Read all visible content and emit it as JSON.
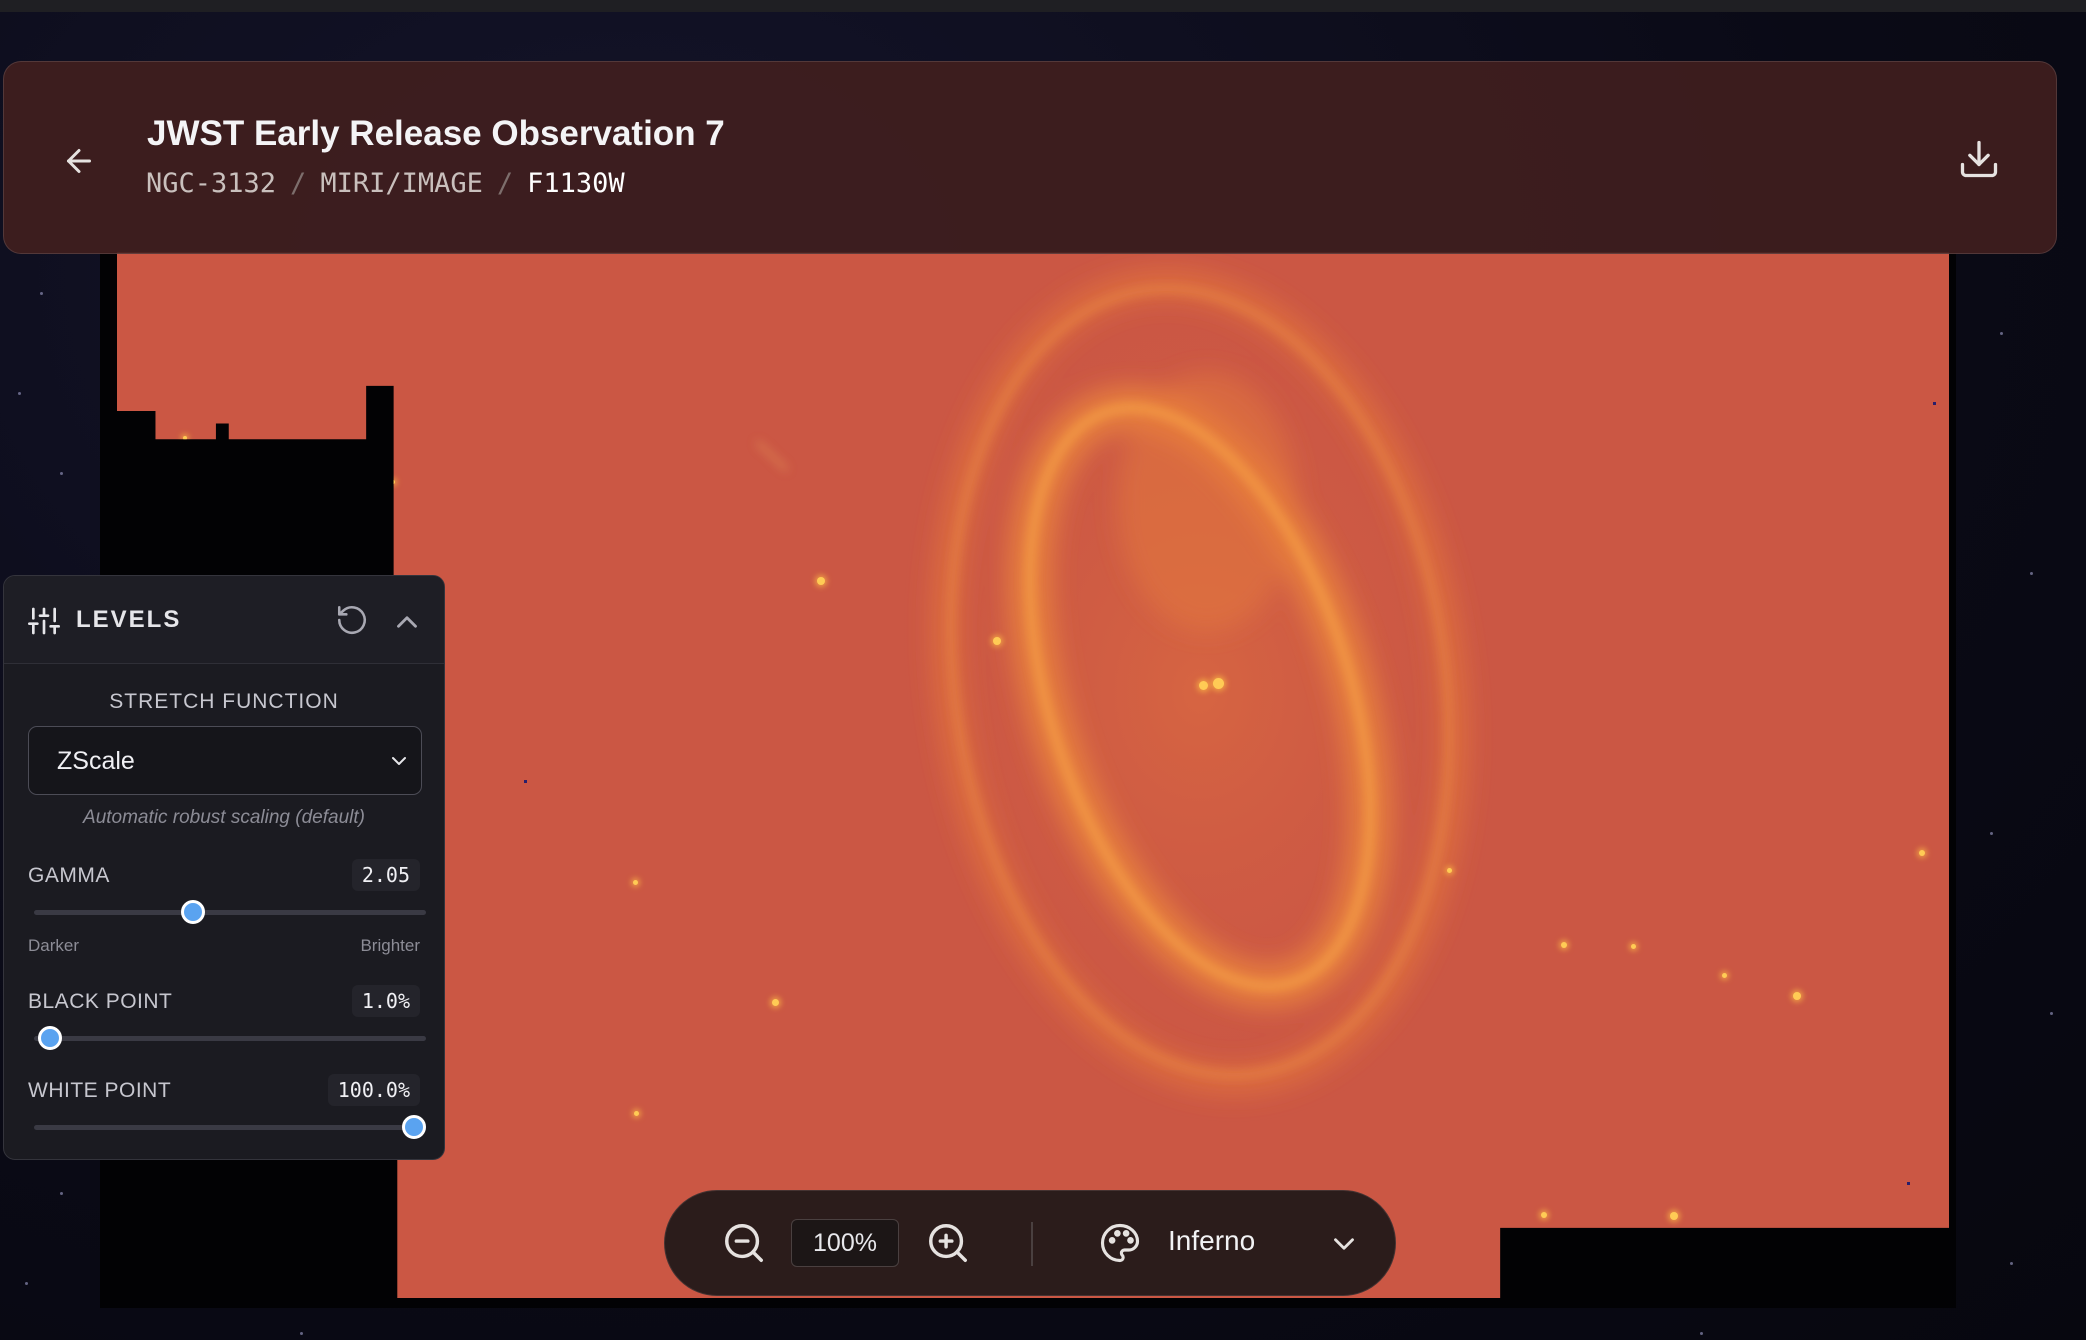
{
  "header": {
    "title": "JWST Early Release Observation 7",
    "breadcrumbs": [
      "NGC-3132",
      "MIRI/IMAGE",
      "F1130W"
    ],
    "separator": "/"
  },
  "levels": {
    "title": "LEVELS",
    "stretch_label": "STRETCH FUNCTION",
    "stretch_value": "ZScale",
    "stretch_hint": "Automatic robust scaling (default)",
    "gamma": {
      "label": "GAMMA",
      "display": "2.05",
      "min_label": "Darker",
      "max_label": "Brighter",
      "fraction": 0.4
    },
    "black_point": {
      "label": "BLACK POINT",
      "display": "1.0%",
      "fraction": 0.01
    },
    "white_point": {
      "label": "WHITE POINT",
      "display": "100.0%",
      "fraction": 1.0
    }
  },
  "toolbar": {
    "zoom": "100%",
    "colormap": "Inferno"
  },
  "icons": [
    "arrow-left-icon",
    "download-icon",
    "sliders-icon",
    "reset-icon",
    "chevron-up-icon",
    "chevron-down-icon",
    "zoom-out-icon",
    "zoom-in-icon",
    "palette-icon"
  ],
  "colors": {
    "accent": "#5aa3f0",
    "header_bg": "#401e1e",
    "image_bg": "#cb5744",
    "nebula": "#f08a3a"
  }
}
